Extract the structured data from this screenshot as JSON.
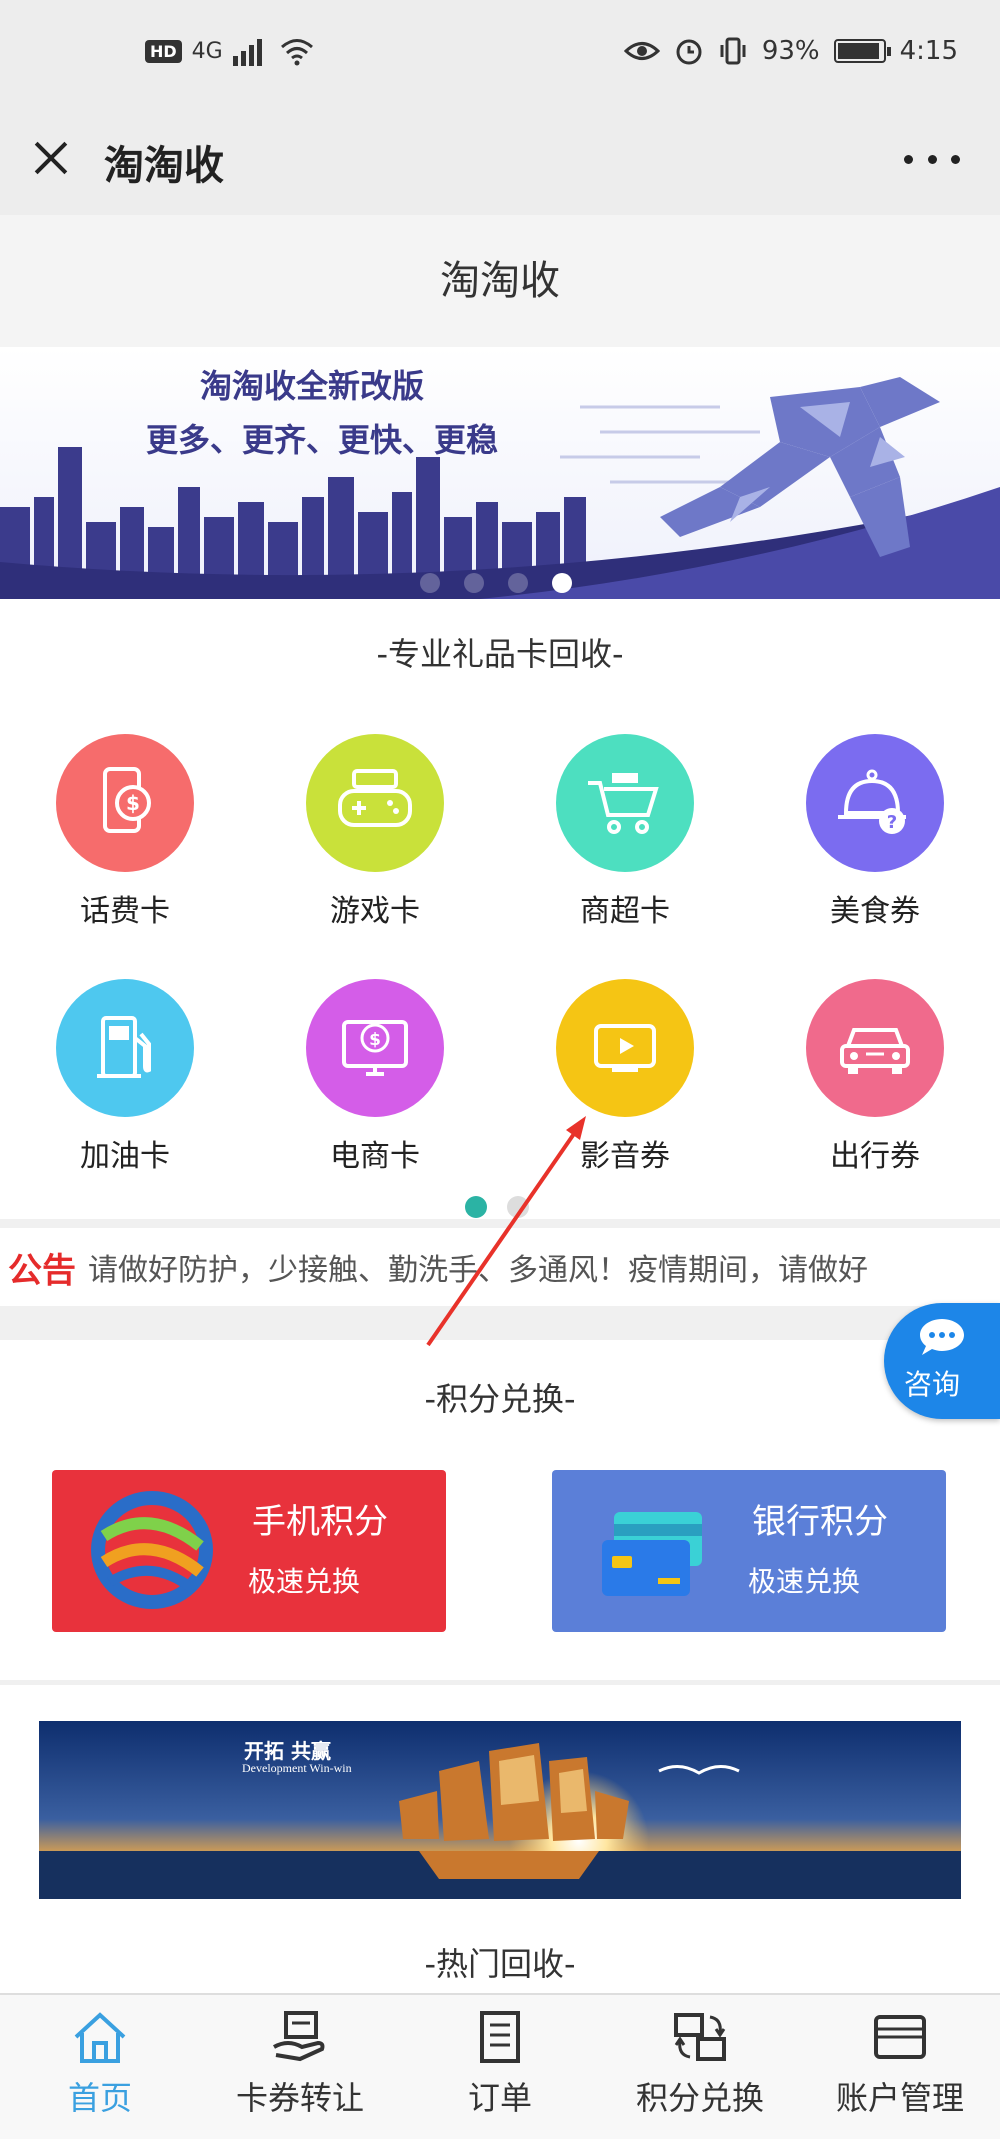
{
  "status_bar": {
    "hd_badge": "HD",
    "network": "4G",
    "battery_percent": "93%",
    "battery_level": 0.93,
    "time": "4:15"
  },
  "title_bar": {
    "title": "淘淘收"
  },
  "page_header": {
    "title": "淘淘收"
  },
  "banner": {
    "title": "淘淘收全新改版",
    "subtitle": "更多、更齐、更快、更稳",
    "slide_count": 4,
    "active_slide": 4
  },
  "gift_cards": {
    "section_title": "-专业礼品卡回收-",
    "items": [
      {
        "label": "话费卡",
        "color": "#f66c6c",
        "icon": "phone-dollar-icon"
      },
      {
        "label": "游戏卡",
        "color": "#c9e13a",
        "icon": "gamepad-icon"
      },
      {
        "label": "商超卡",
        "color": "#4ddfc0",
        "icon": "cart-icon"
      },
      {
        "label": "美食券",
        "color": "#7b6cf0",
        "icon": "food-cover-icon"
      },
      {
        "label": "加油卡",
        "color": "#4ec8ef",
        "icon": "fuel-pump-icon"
      },
      {
        "label": "电商卡",
        "color": "#d45de8",
        "icon": "monitor-dollar-icon"
      },
      {
        "label": "影音券",
        "color": "#f5c514",
        "icon": "tv-play-icon"
      },
      {
        "label": "出行券",
        "color": "#f06a8c",
        "icon": "car-icon"
      }
    ],
    "page_count": 2,
    "active_page": 1
  },
  "notice": {
    "label": "公告",
    "text": "请做好防护，少接触、勤洗手、多通风！疫情期间，请做好"
  },
  "consult_button": {
    "label": "咨询"
  },
  "points": {
    "section_title": "-积分兑换-",
    "cards": [
      {
        "title": "手机积分",
        "subtitle": "极速兑换",
        "color": "#e8323c"
      },
      {
        "title": "银行积分",
        "subtitle": "极速兑换",
        "color": "#5b7fd8"
      }
    ]
  },
  "promo_banner": {
    "title": "开拓 共赢",
    "subtitle": "Development Win-win"
  },
  "hot": {
    "section_title": "-热门回收-"
  },
  "tabbar": {
    "tabs": [
      {
        "label": "首页",
        "icon": "home-icon",
        "active": true
      },
      {
        "label": "卡券转让",
        "icon": "card-hand-icon",
        "active": false
      },
      {
        "label": "订单",
        "icon": "document-list-icon",
        "active": false
      },
      {
        "label": "积分兑换",
        "icon": "exchange-icon",
        "active": false
      },
      {
        "label": "账户管理",
        "icon": "wallet-icon",
        "active": false
      }
    ]
  }
}
